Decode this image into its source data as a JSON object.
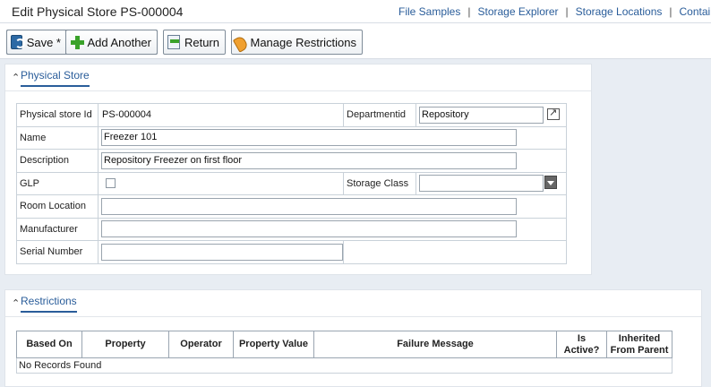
{
  "page": {
    "title": "Edit Physical Store PS-000004"
  },
  "top_links": [
    "File Samples",
    "Storage Explorer",
    "Storage Locations",
    "Contai"
  ],
  "toolbar": {
    "save_label": "Save *",
    "add_another_label": "Add Another",
    "return_label": "Return",
    "manage_restrictions_label": "Manage Restrictions"
  },
  "physical_store": {
    "section_title": "Physical Store",
    "fields": {
      "physical_store_id": {
        "label": "Physical store Id",
        "value": "PS-000004"
      },
      "department_id": {
        "label": "Departmentid",
        "value": "Repository"
      },
      "name": {
        "label": "Name",
        "value": "Freezer 101"
      },
      "description": {
        "label": "Description",
        "value": "Repository Freezer on first floor"
      },
      "glp": {
        "label": "GLP",
        "checked": false
      },
      "storage_class": {
        "label": "Storage Class",
        "value": ""
      },
      "room_location": {
        "label": "Room Location",
        "value": ""
      },
      "manufacturer": {
        "label": "Manufacturer",
        "value": ""
      },
      "serial_number": {
        "label": "Serial Number",
        "value": ""
      }
    }
  },
  "restrictions": {
    "section_title": "Restrictions",
    "columns": [
      "Based On",
      "Property",
      "Operator",
      "Property Value",
      "Failure Message",
      "Is Active?",
      "Inherited From Parent"
    ],
    "empty_message": "No Records Found"
  },
  "colors": {
    "link": "#2a5d9a",
    "background": "#e8edf3",
    "panel": "#ffffff",
    "border": "#c9d1d9"
  }
}
